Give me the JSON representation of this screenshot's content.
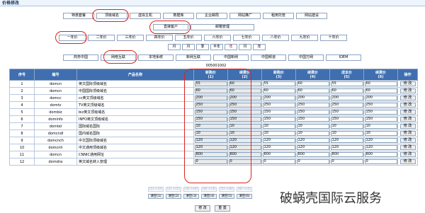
{
  "title": "价格修改",
  "row1": [
    "特惠套餐",
    "顶级域名",
    "虚拟主机",
    "数据库",
    "企业邮局",
    "网站推广",
    "租用托管",
    "网站建设"
  ],
  "row2": [
    "直接客户",
    "邮箱管理"
  ],
  "row3": [
    "一年价",
    "二年价",
    "三年价",
    "四年价",
    "五年价",
    "六年价",
    "七年价",
    "八年价",
    "九年价",
    "十年价"
  ],
  "row4": [
    "月",
    "月",
    "季",
    "半年",
    "年",
    "月",
    "年"
  ],
  "row4_selected": 4,
  "row5": [
    "商务中国",
    "网络互联",
    "本地系统",
    "新网互联",
    "中国新网",
    "中国频道",
    "中国万网",
    "IDEM"
  ],
  "pcode": "005001002",
  "headers": [
    "序号",
    "编号",
    "产品名称",
    "新购价\n(1)",
    "续费价\n(2)",
    "新购价\n(3)",
    "续费价\n(4)",
    "成本价\n(5)",
    "续费价\n(6)",
    "操作"
  ],
  "rows": [
    {
      "n": "1",
      "code": "domcn",
      "name": "英文国际顶级域名",
      "v": [
        "55",
        "60",
        "55",
        "60",
        "55",
        "60"
      ]
    },
    {
      "n": "2",
      "code": "domcn",
      "name": "中国国际顶级域名",
      "v": [
        "60",
        "60",
        "60",
        "60",
        "60",
        "60"
      ]
    },
    {
      "n": "3",
      "code": "domcc",
      "name": "cc英文顶级域名",
      "v": [
        "200",
        "200",
        "200",
        "200",
        "200",
        "200"
      ]
    },
    {
      "n": "4",
      "code": "domtv",
      "name": "TV英文顶级域名",
      "v": [
        "250",
        "250",
        "250",
        "250",
        "250",
        "250"
      ]
    },
    {
      "n": "5",
      "code": "dombiz",
      "name": "biz英文顶级域名",
      "v": [
        "150",
        "150",
        "150",
        "150",
        "150",
        "150"
      ]
    },
    {
      "n": "6",
      "code": "dominfo",
      "name": "INFO英文顶级域名",
      "v": [
        "150",
        "150",
        "150",
        "150",
        "150",
        "150"
      ]
    },
    {
      "n": "7",
      "code": "domtel",
      "name": "国际域名国际",
      "v": [
        "10",
        "10",
        "10",
        "10",
        "10",
        "10"
      ]
    },
    {
      "n": "8",
      "code": "domcndl",
      "name": "国内域名国际",
      "v": [
        "10",
        "10",
        "10",
        "10",
        "10",
        "10"
      ]
    },
    {
      "n": "9",
      "code": "domcnch",
      "name": "中文国际顶级域名",
      "v": [
        "120",
        "120",
        "120",
        "120",
        "120",
        "120"
      ]
    },
    {
      "n": "10",
      "code": "domcnh",
      "name": "中文通用顶级域名",
      "v": [
        "120",
        "120",
        "120",
        "120",
        "120",
        "120"
      ]
    },
    {
      "n": "11",
      "code": "domcn",
      "name": "CNNIC通用网址",
      "v": [
        "800",
        "800",
        "800",
        "800",
        "800",
        "800"
      ]
    },
    {
      "n": "12",
      "code": "domdns",
      "name": "英文域名转入管理",
      "v": [
        "0",
        "0",
        "0",
        "0",
        "0",
        "0"
      ]
    }
  ],
  "edit_label": "修 改",
  "pager": [
    "(1)->(2)",
    "(2)->(1)",
    "(3)->(4)",
    "(4)->(3)",
    "(5)->(6)",
    "(6)->(5)"
  ],
  "clear_label": "清空(1)",
  "clears": [
    "清空(1)",
    "清空(2)",
    "清空(3)",
    "清空(4)",
    "清空(5)",
    "清空(6)"
  ],
  "submit": "修 改",
  "reset": "重 置",
  "watermark": "破蜗壳国际云服务",
  "colors": {
    "header": "#3f6fb0",
    "highlight": "#d9251d"
  }
}
